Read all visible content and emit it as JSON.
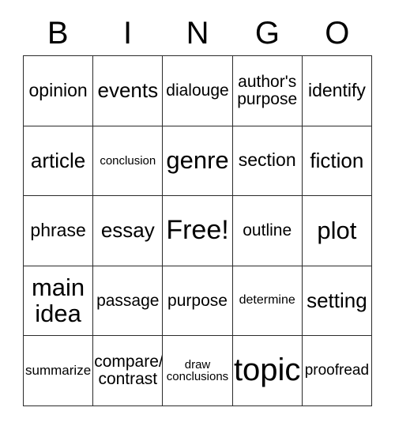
{
  "card": {
    "title_letters": [
      "B",
      "I",
      "N",
      "G",
      "O"
    ],
    "grid_size": "5x5",
    "line_color": "#2b2b2b",
    "background_color": "#ffffff",
    "text_color": "#000000",
    "rows": [
      [
        {
          "text": "opinion",
          "size": "fs-l"
        },
        {
          "text": "events",
          "size": "fs-xl"
        },
        {
          "text": "dialouge",
          "size": "fs-ml"
        },
        {
          "text": "author's\npurpose",
          "size": "fs-ml"
        },
        {
          "text": "identify",
          "size": "fs-l"
        }
      ],
      [
        {
          "text": "article",
          "size": "fs-xl"
        },
        {
          "text": "conclusion",
          "size": "fs-xs"
        },
        {
          "text": "genre",
          "size": "fs-xxl"
        },
        {
          "text": "section",
          "size": "fs-l"
        },
        {
          "text": "fiction",
          "size": "fs-xl"
        }
      ],
      [
        {
          "text": "phrase",
          "size": "fs-l"
        },
        {
          "text": "essay",
          "size": "fs-xl"
        },
        {
          "text": "Free!",
          "size": "fs-huge"
        },
        {
          "text": "outline",
          "size": "fs-ml"
        },
        {
          "text": "plot",
          "size": "fs-xxl"
        }
      ],
      [
        {
          "text": "main\nidea",
          "size": "fs-xxl"
        },
        {
          "text": "passage",
          "size": "fs-ml"
        },
        {
          "text": "purpose",
          "size": "fs-ml"
        },
        {
          "text": "determine",
          "size": "fs-s"
        },
        {
          "text": "setting",
          "size": "fs-xl"
        }
      ],
      [
        {
          "text": "summarize",
          "size": "fs-sm"
        },
        {
          "text": "compare/\ncontrast",
          "size": "fs-ml"
        },
        {
          "text": "draw\nconclusions",
          "size": "fs-xs"
        },
        {
          "text": "topic",
          "size": "fs-mega"
        },
        {
          "text": "proofread",
          "size": "fs-m"
        }
      ]
    ]
  }
}
